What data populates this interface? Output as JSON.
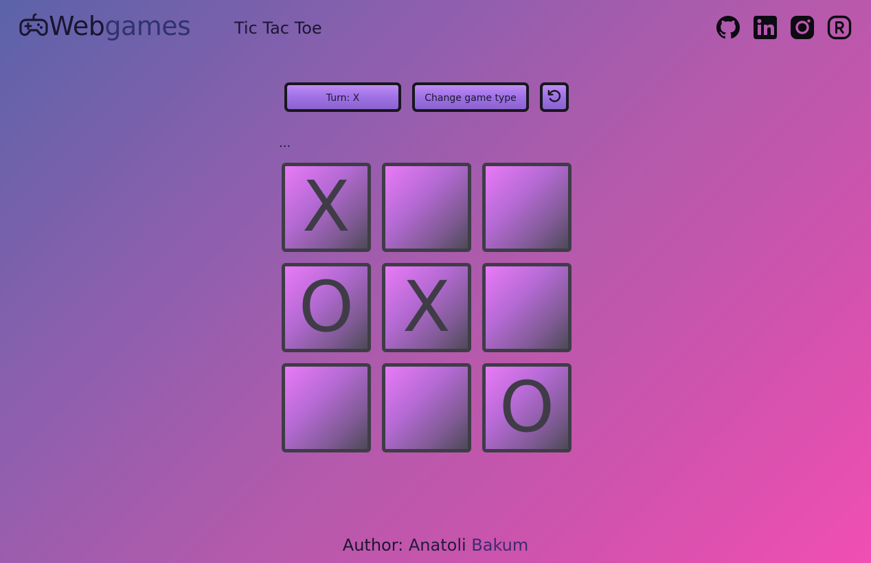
{
  "header": {
    "logo_part1": "Web",
    "logo_part2": "games",
    "logo_icon": "gamepad-icon",
    "nav_title": "Tic Tac Toe",
    "socials": [
      {
        "name": "github-icon"
      },
      {
        "name": "linkedin-icon"
      },
      {
        "name": "instagram-icon"
      },
      {
        "name": "r-icon"
      }
    ]
  },
  "controls": {
    "turn_label": "Turn: X",
    "change_label": "Change game type",
    "reset_icon": "reset-icon"
  },
  "status": "...",
  "board": {
    "cells": [
      "X",
      "",
      "",
      "O",
      "X",
      "",
      "",
      "",
      "O"
    ]
  },
  "footer": {
    "label": "Author:",
    "first_name": "Anatoli",
    "last_name": "Bakum"
  },
  "colors": {
    "cell_border": "#3f3c47",
    "button_border": "#18161f",
    "button_fill": "#a173e6",
    "background_start": "#5b63a9",
    "background_end": "#f14eb2"
  }
}
